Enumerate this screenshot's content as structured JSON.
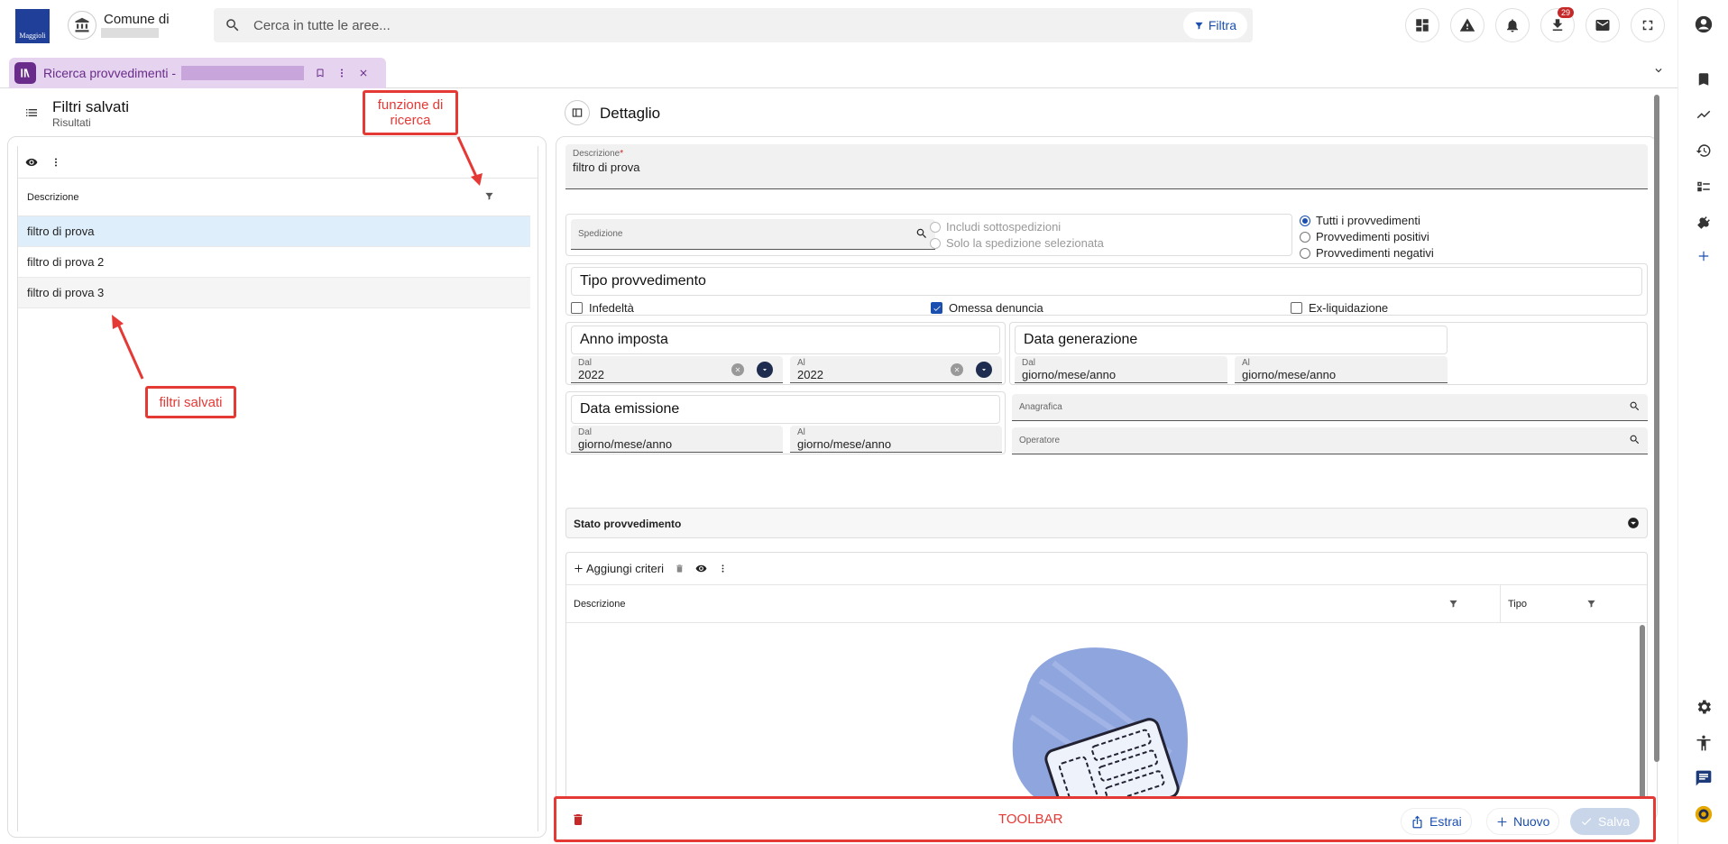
{
  "header": {
    "logo_text": "Maggioli",
    "comune_title": "Comune di",
    "search_placeholder": "Cerca in tutte le aree...",
    "filter_label": "Filtra",
    "download_badge": "29"
  },
  "tab": {
    "label": "Ricerca provvedimenti -"
  },
  "left": {
    "title": "Filtri salvati",
    "subtitle": "Risultati",
    "column_header": "Descrizione",
    "rows": [
      "filtro di prova",
      "filtro di prova 2",
      "filtro di prova 3"
    ],
    "annotation_search": "funzione di ricerca",
    "annotation_saved": "filtri salvati"
  },
  "detail": {
    "title": "Dettaglio",
    "descrizione_label": "Descrizione",
    "required_mark": "*",
    "descrizione_value": "filtro di prova",
    "spedizione_label": "Spedizione",
    "includi_label": "Includi sottospedizioni",
    "solo_label": "Solo la spedizione selezionata",
    "radio_tutti": "Tutti i provvedimenti",
    "radio_positivi": "Provvedimenti positivi",
    "radio_negativi": "Provvedimenti negativi",
    "tipo_title": "Tipo provvedimento",
    "chk_infedelta": "Infedeltà",
    "chk_omessa": "Omessa denuncia",
    "chk_exliq": "Ex-liquidazione",
    "anno_title": "Anno imposta",
    "dal_label": "Dal",
    "al_label": "Al",
    "anno_dal": "2022",
    "anno_al": "2022",
    "datagen_title": "Data generazione",
    "date_placeholder": "giorno/mese/anno",
    "dataem_title": "Data emissione",
    "anagrafica_label": "Anagrafica",
    "operatore_label": "Operatore",
    "stato_title": "Stato provvedimento",
    "aggiungi_label": "Aggiungi criteri",
    "col_descrizione": "Descrizione",
    "col_tipo": "Tipo"
  },
  "toolbar": {
    "annotation": "TOOLBAR",
    "estrai": "Estrai",
    "nuovo": "Nuovo",
    "salva": "Salva"
  },
  "colors": {
    "accent": "#1a4fb0",
    "annotation_red": "#e53935",
    "tab_purple": "#6a2c8a"
  }
}
